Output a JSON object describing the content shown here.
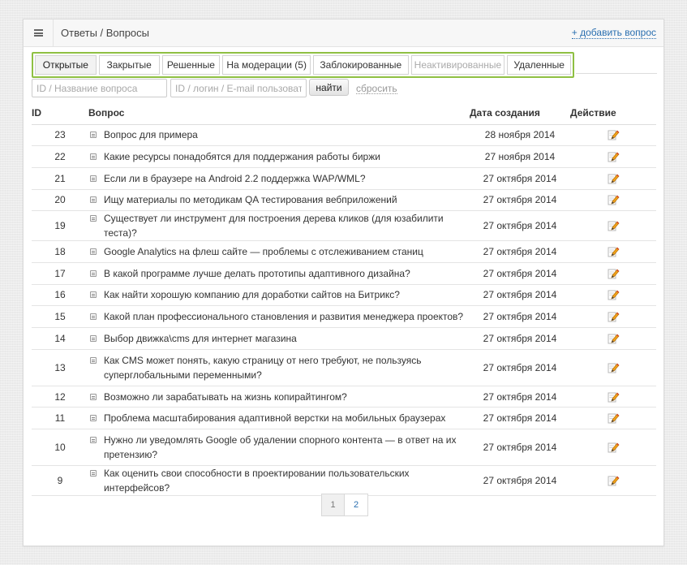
{
  "header": {
    "title": "Ответы / Вопросы",
    "add_link": "+ добавить вопрос"
  },
  "tabs": [
    {
      "label": "Открытые",
      "state": "active"
    },
    {
      "label": "Закрытые",
      "state": "normal"
    },
    {
      "label": "Решенные",
      "state": "normal"
    },
    {
      "label": "На модерации (5)",
      "state": "normal"
    },
    {
      "label": "Заблокированные",
      "state": "normal"
    },
    {
      "label": "Неактивированные",
      "state": "disabled"
    },
    {
      "label": "Удаленные",
      "state": "normal"
    }
  ],
  "filters": {
    "question_placeholder": "ID / Название вопроса",
    "user_placeholder": "ID / логин / E-mail пользователя",
    "find_label": "найти",
    "reset_label": "сбросить"
  },
  "table": {
    "headers": {
      "id": "ID",
      "question": "Вопрос",
      "date": "Дата создания",
      "action": "Действие"
    },
    "rows": [
      {
        "id": "23",
        "question": "Вопрос для примера",
        "date": "28 ноября 2014"
      },
      {
        "id": "22",
        "question": "Какие ресурсы понадобятся для поддержания работы биржи",
        "date": "27 ноября 2014"
      },
      {
        "id": "21",
        "question": "Если ли в браузере на Android 2.2 поддержка WAP/WML?",
        "date": "27 октября 2014"
      },
      {
        "id": "20",
        "question": "Ищу материалы по методикам QA тестирования вебприложений",
        "date": "27 октября 2014"
      },
      {
        "id": "19",
        "question": "Существует ли инструмент для построения дерева кликов (для юзабилити теста)?",
        "date": "27 октября 2014"
      },
      {
        "id": "18",
        "question": "Google Analytics на флеш сайте — проблемы с отслеживанием станиц",
        "date": "27 октября 2014"
      },
      {
        "id": "17",
        "question": "В какой программе лучше делать прототипы адаптивного дизайна?",
        "date": "27 октября 2014"
      },
      {
        "id": "16",
        "question": "Как найти хорошую компанию для доработки сайтов на Битрикс?",
        "date": "27 октября 2014"
      },
      {
        "id": "15",
        "question": "Какой план профессионального становления и развития менеджера проектов?",
        "date": "27 октября 2014"
      },
      {
        "id": "14",
        "question": "Выбор движка\\cms для интернет магазина",
        "date": "27 октября 2014"
      },
      {
        "id": "13",
        "question": "Как CMS может понять, какую страницу от него требуют, не пользуясь суперглобальными переменными?",
        "date": "27 октября 2014"
      },
      {
        "id": "12",
        "question": "Возможно ли зарабатывать на жизнь копирайтингом?",
        "date": "27 октября 2014"
      },
      {
        "id": "11",
        "question": "Проблема масштабирования адаптивной верстки на мобильных браузерах",
        "date": "27 октября 2014"
      },
      {
        "id": "10",
        "question": "Нужно ли уведомлять Google об удалении спорного контента — в ответ на их претензию?",
        "date": "27 октября 2014"
      },
      {
        "id": "9",
        "question": "Как оценить свои способности в проектировании пользовательских интерфейсов?",
        "date": "27 октября 2014"
      }
    ],
    "action_icon": "edit-pencil-icon"
  },
  "pagination": {
    "pages": [
      "1",
      "2"
    ],
    "current": "1"
  },
  "colors": {
    "tabs_highlight": "#8fc043",
    "link": "#2a6fb0"
  }
}
